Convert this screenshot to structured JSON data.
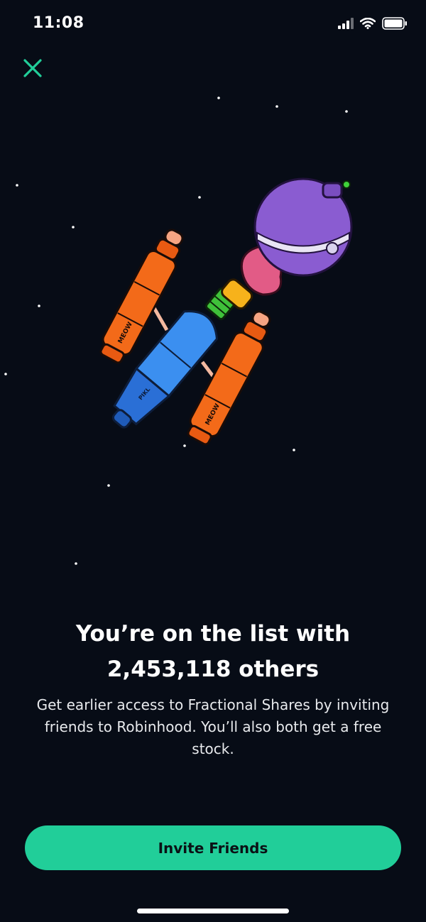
{
  "status_bar": {
    "time": "11:08",
    "icons": [
      "signal-icon",
      "wifi-icon",
      "battery-icon"
    ]
  },
  "close": {
    "icon": "close-icon",
    "color": "#21ce99"
  },
  "illustration": {
    "name": "rocket-illustration",
    "booster_label_left": "MEOW",
    "booster_label_right": "MEOW",
    "body_label": "PIKL"
  },
  "headline": {
    "line1": "You’re on the list with",
    "line2": "2,453,118 others"
  },
  "description": {
    "line1": "Get earlier access to Fractional Shares by inviting",
    "line2": "friends to Robinhood. You’ll also both get a free",
    "line3": "stock."
  },
  "cta": {
    "label": "Invite Friends",
    "color": "#21ce99"
  },
  "theme": {
    "background": "#070c16",
    "accent": "#21ce99"
  }
}
